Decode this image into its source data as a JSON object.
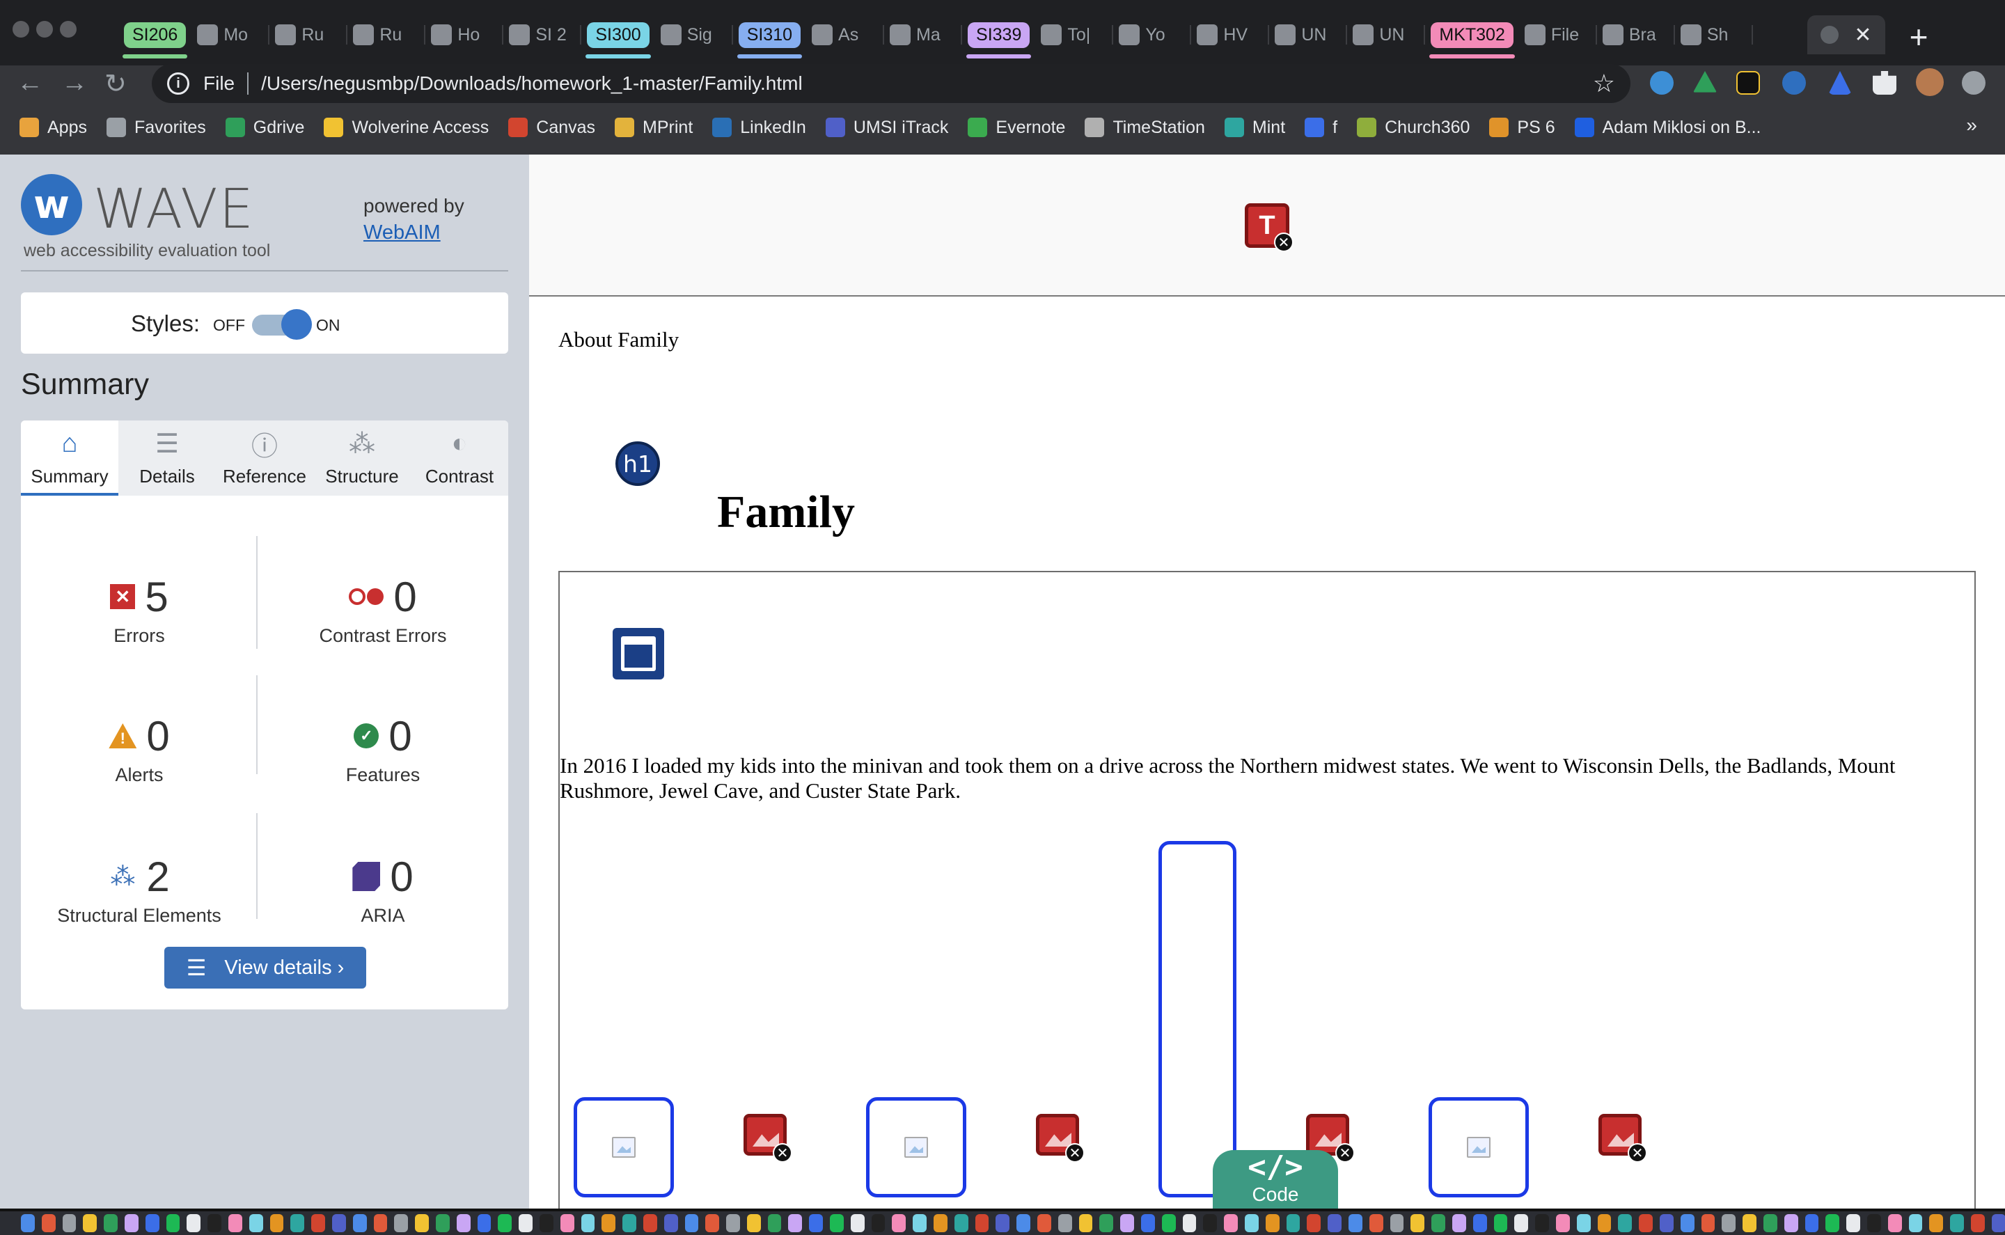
{
  "browser": {
    "tabs": [
      {
        "label": "SI206",
        "type": "chip",
        "chip_color": "#7fd18b",
        "underline": "#7fd18b"
      },
      {
        "label": "Mo",
        "icon": "doc-icon"
      },
      {
        "label": "Ru",
        "icon": "doc-icon"
      },
      {
        "label": "Ru",
        "icon": "doc-icon"
      },
      {
        "label": "Ho",
        "icon": "canvas-icon"
      },
      {
        "label": "SI 2",
        "icon": "slides-icon"
      },
      {
        "label": "SI300",
        "type": "chip",
        "chip_color": "#7ad4e6",
        "underline": "#7ad4e6"
      },
      {
        "label": "Sig",
        "icon": "doc-icon"
      },
      {
        "label": "SI310",
        "type": "chip",
        "chip_color": "#86aef0",
        "underline": "#86aef0"
      },
      {
        "label": "As",
        "icon": "canvas-icon"
      },
      {
        "label": "Ma",
        "icon": "search-icon"
      },
      {
        "label": "SI339",
        "type": "chip",
        "chip_color": "#c9a6f4",
        "underline": "#c9a6f4"
      },
      {
        "label": "To|",
        "icon": "canvas-icon"
      },
      {
        "label": "Yo",
        "icon": "canvas-icon"
      },
      {
        "label": "HV",
        "icon": "docs-icon"
      },
      {
        "label": "UN",
        "icon": "github-icon"
      },
      {
        "label": "UN",
        "icon": "github-icon"
      },
      {
        "label": "MKT302",
        "type": "chip",
        "chip_color": "#f38bb8",
        "underline": "#f38bb8"
      },
      {
        "label": "File",
        "icon": "canvas-icon"
      },
      {
        "label": "Bra",
        "icon": "wordpress-icon"
      },
      {
        "label": "Sh",
        "icon": "nu-icon"
      }
    ],
    "url": "/Users/negusmbp/Downloads/homework_1-master/Family.html",
    "url_scheme_label": "File",
    "bookmarks": [
      {
        "label": "Apps",
        "color": "#e8a33d"
      },
      {
        "label": "Favorites",
        "color": "#9aa0a6"
      },
      {
        "label": "Gdrive",
        "color": "#2f9f5a"
      },
      {
        "label": "Wolverine Access",
        "color": "#f1c232"
      },
      {
        "label": "Canvas",
        "color": "#d2452f"
      },
      {
        "label": "MPrint",
        "color": "#e3b33c"
      },
      {
        "label": "LinkedIn",
        "color": "#2a6fb5"
      },
      {
        "label": "UMSI iTrack",
        "color": "#5060c8"
      },
      {
        "label": "Evernote",
        "color": "#3bab4f"
      },
      {
        "label": "TimeStation",
        "color": "#b0b0b0"
      },
      {
        "label": "Mint",
        "color": "#2ea6a0"
      },
      {
        "label": "f",
        "color": "#3b6ee8"
      },
      {
        "label": "Church360",
        "color": "#8fae3c"
      },
      {
        "label": "PS 6",
        "color": "#e0932a"
      },
      {
        "label": "Adam Miklosi on B...",
        "color": "#1f5fe0"
      }
    ],
    "bookmarks_more": "»"
  },
  "wave": {
    "title": "WAVE",
    "subtitle": "web accessibility evaluation tool",
    "powered_by": "powered by",
    "webaim_link": "WebAIM",
    "styles_label": "Styles:",
    "styles_off": "OFF",
    "styles_on": "ON",
    "styles_enabled": true,
    "summary_heading": "Summary",
    "tabs": [
      {
        "label": "Summary",
        "icon": "home-icon"
      },
      {
        "label": "Details",
        "icon": "list-icon"
      },
      {
        "label": "Reference",
        "icon": "info-icon"
      },
      {
        "label": "Structure",
        "icon": "structure-icon"
      },
      {
        "label": "Contrast",
        "icon": "contrast-icon"
      }
    ],
    "active_tab": "Summary",
    "stats": {
      "errors": {
        "count": "5",
        "label": "Errors",
        "color": "#c82f2f"
      },
      "contrast_errors": {
        "count": "0",
        "label": "Contrast Errors",
        "color": "#c82f2f"
      },
      "alerts": {
        "count": "0",
        "label": "Alerts",
        "color": "#e39421"
      },
      "features": {
        "count": "0",
        "label": "Features",
        "color": "#2e8a4c"
      },
      "structural": {
        "count": "2",
        "label": "Structural Elements",
        "color": "#3a6fb6"
      },
      "aria": {
        "count": "0",
        "label": "ARIA",
        "color": "#4b3a8c"
      }
    },
    "view_details": "View details ›"
  },
  "page": {
    "about": "About Family",
    "h1_badge": "h1",
    "heading": "Family",
    "paragraph": "In 2016 I loaded my kids into the minivan and took them on a drive across the Northern midwest states. We went to Wisconsin Dells, the Badlands, Mount Rushmore, Jewel Cave, and Custer State Park.",
    "code_button": "Code",
    "code_icon": "</>",
    "error_badge": "T"
  },
  "colors": {
    "wave_blue": "#2f6fbf",
    "error_red": "#c82f2f",
    "image_outline": "#1b39e6",
    "code_green": "#3d9a83"
  }
}
